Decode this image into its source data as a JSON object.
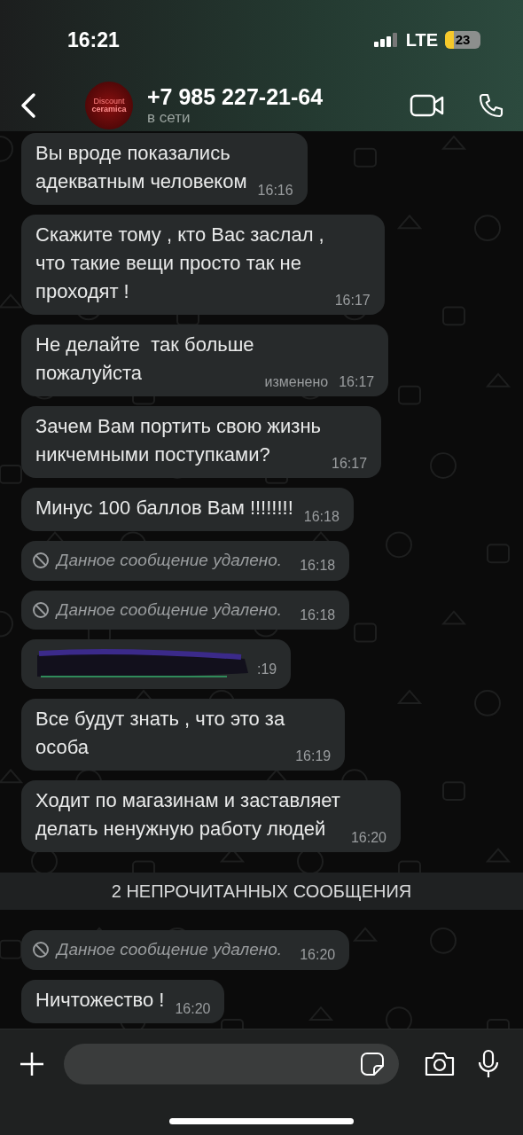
{
  "status_bar": {
    "time": "16:21",
    "network": "LTE",
    "battery": "23"
  },
  "header": {
    "logo_texts": [
      "Discount",
      "ceramica"
    ],
    "contact": "+7 985 227-21-64",
    "status": "в сети"
  },
  "messages": [
    {
      "kind": "text",
      "text": "Вы вроде показались\nадекватным человеком",
      "time": "16:16"
    },
    {
      "kind": "text",
      "text": "Скажите тому , кто Вас заслал ,\nчто такие вещи просто так не\nпроходят !",
      "time": "16:17"
    },
    {
      "kind": "text",
      "text": "Не делайте  так больше\nпожалуйста",
      "edited": "изменено",
      "time": "16:17"
    },
    {
      "kind": "text",
      "text": "Зачем Вам портить свою жизнь\nникчемными поступками?",
      "time": "16:17"
    },
    {
      "kind": "text",
      "text": "Минус 100 баллов Вам !!!!!!!!",
      "time": "16:18"
    },
    {
      "kind": "deleted",
      "text": "Данное сообщение удалено.",
      "time": "16:18"
    },
    {
      "kind": "deleted",
      "text": "Данное сообщение удалено.",
      "time": "16:18"
    },
    {
      "kind": "redacted",
      "time": ":19"
    },
    {
      "kind": "text",
      "text": "Все будут знать , что это за\nособа",
      "time": "16:19"
    },
    {
      "kind": "text",
      "text": "Ходит по магазинам и заставляет\nделать ненужную работу людей",
      "time": "16:20"
    },
    {
      "kind": "divider",
      "text": "2 НЕПРОЧИТАННЫХ СООБЩЕНИЯ"
    },
    {
      "kind": "deleted",
      "text": "Данное сообщение удалено.",
      "time": "16:20"
    },
    {
      "kind": "text",
      "text": "Ничтожество !",
      "time": "16:20"
    }
  ]
}
